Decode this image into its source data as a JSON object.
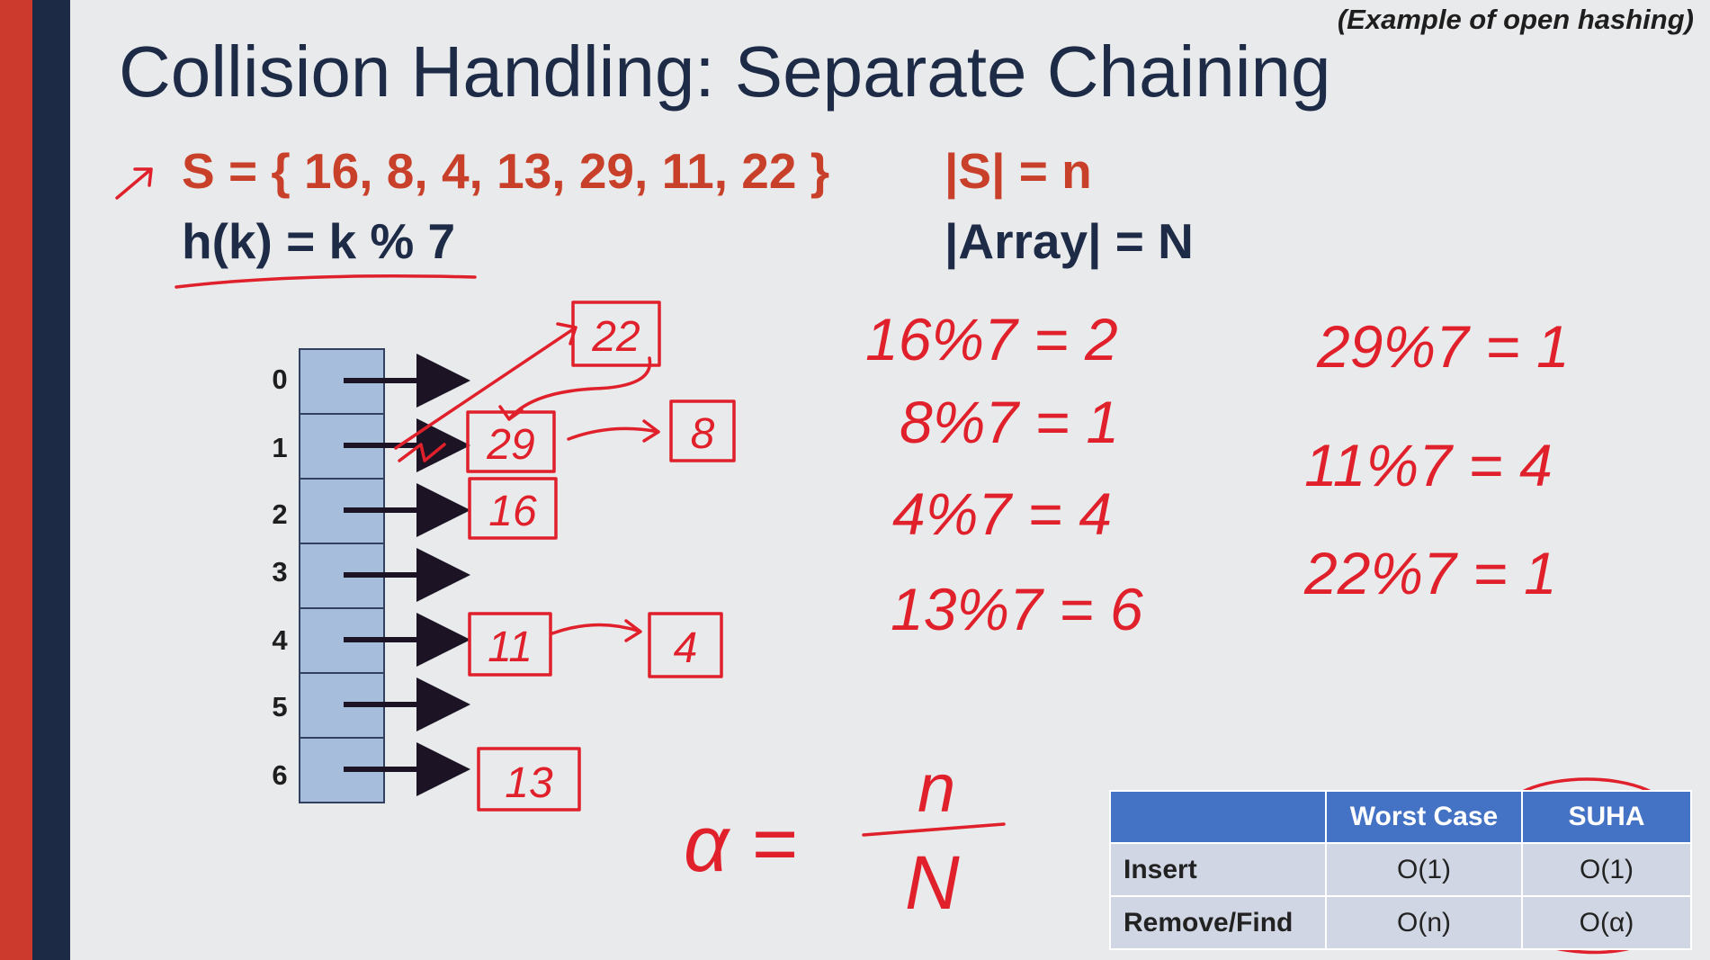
{
  "slide": {
    "note": "(Example of open hashing)",
    "title": "Collision Handling: Separate Chaining",
    "set_def": "S = { 16, 8, 4, 13, 29, 11, 22 }",
    "hash_fn": "h(k) = k % 7",
    "set_size": "|S| = n",
    "array_size": "|Array| = N"
  },
  "buckets": [
    "0",
    "1",
    "2",
    "3",
    "4",
    "5",
    "6"
  ],
  "chains": {
    "b1": [
      "22",
      "29",
      "8"
    ],
    "b2": [
      "16"
    ],
    "b4": [
      "11",
      "4"
    ],
    "b6": [
      "13"
    ]
  },
  "computations": {
    "left": [
      "16%7 = 2",
      "8%7 = 1",
      "4%7 = 4",
      "13%7 = 6"
    ],
    "right": [
      "29%7 = 1",
      "11%7 = 4",
      "22%7 = 1"
    ]
  },
  "load_factor": {
    "lhs": "α =",
    "num": "n",
    "den": "N"
  },
  "table": {
    "headers": [
      "",
      "Worst Case",
      "SUHA"
    ],
    "rows": [
      {
        "op": "Insert",
        "worst": "O(1)",
        "suha": "O(1)"
      },
      {
        "op": "Remove/Find",
        "worst": "O(n)",
        "suha": "O(α)"
      }
    ]
  },
  "colors": {
    "accent_red": "#c9402a",
    "navy": "#1e2b47",
    "ink": "#e0202a",
    "table_header": "#4472c4"
  }
}
